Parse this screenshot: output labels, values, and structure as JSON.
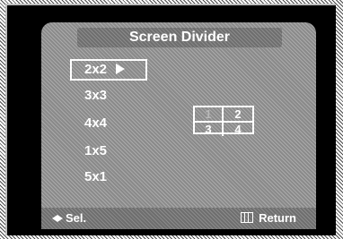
{
  "title": "Screen Divider",
  "menu": {
    "items": [
      {
        "label": "2x2",
        "selected": true
      },
      {
        "label": "3x3",
        "selected": false
      },
      {
        "label": "4x4",
        "selected": false
      },
      {
        "label": "1x5",
        "selected": false
      },
      {
        "label": "5x1",
        "selected": false
      }
    ]
  },
  "preview": {
    "cells": [
      "1",
      "2",
      "3",
      "4"
    ],
    "highlighted_cell": "1"
  },
  "footer": {
    "left_label": "Sel.",
    "left_icon": "left-right-arrows-icon",
    "right_label": "Return",
    "right_icon": "menu-icon"
  },
  "colors": {
    "panel": "#8a8a8a",
    "bar": "#6e6e6e",
    "text": "#ffffff",
    "highlighted_cell_text": "#b8b8b8"
  }
}
